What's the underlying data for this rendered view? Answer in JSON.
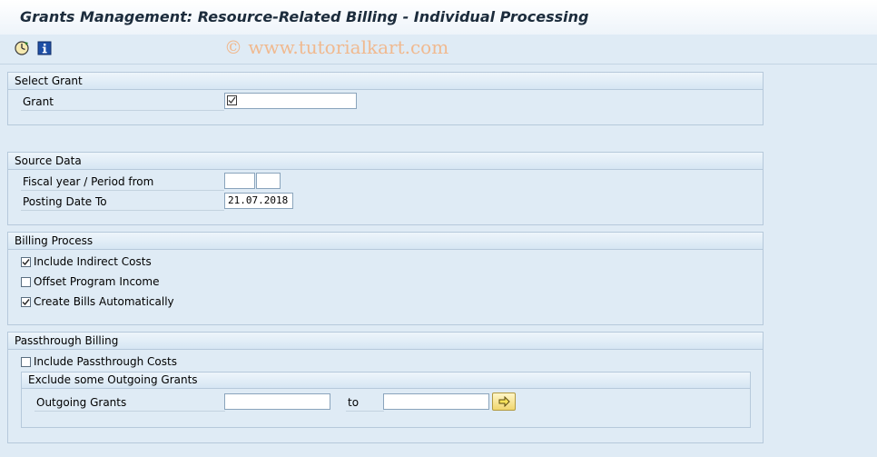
{
  "header": {
    "title": "Grants Management: Resource-Related Billing - Individual Processing"
  },
  "toolbar": {
    "items": [
      {
        "name": "execute-icon"
      },
      {
        "name": "information-icon"
      }
    ]
  },
  "watermark": "© www.tutorialkart.com",
  "select_grant": {
    "title": "Select Grant",
    "grant_label": "Grant",
    "grant_value": ""
  },
  "source_data": {
    "title": "Source Data",
    "fiscal_label": "Fiscal year / Period from",
    "fiscal_year": "",
    "period": "",
    "posting_label": "Posting Date To",
    "posting_value": "21.07.2018"
  },
  "billing_process": {
    "title": "Billing Process",
    "options": [
      {
        "label": "Include Indirect Costs",
        "checked": true
      },
      {
        "label": "Offset Program Income",
        "checked": false
      },
      {
        "label": "Create Bills Automatically",
        "checked": true
      }
    ]
  },
  "passthrough": {
    "title": "Passthrough Billing",
    "include_label": "Include Passthrough Costs",
    "include_checked": false,
    "exclude_title": "Exclude some Outgoing Grants",
    "outgoing_label": "Outgoing Grants",
    "outgoing_from": "",
    "to_label": "to",
    "outgoing_to": ""
  },
  "colors": {
    "background": "#dfebf5",
    "title_text": "#1c2c3c",
    "watermark": "#f0b98f",
    "multi_button": "#f0d66e"
  }
}
